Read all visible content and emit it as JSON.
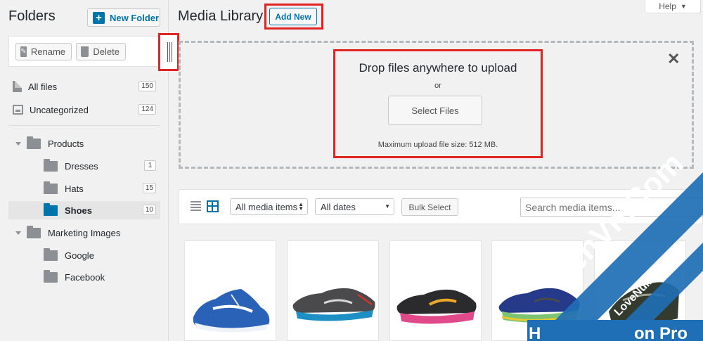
{
  "sidebar": {
    "title": "Folders",
    "new_folder_label": "New Folder",
    "rename_label": "Rename",
    "delete_label": "Delete",
    "all_files": {
      "label": "All files",
      "count": "150"
    },
    "uncategorized": {
      "label": "Uncategorized",
      "count": "124"
    },
    "folders": [
      {
        "label": "Products"
      },
      {
        "label": "Dresses",
        "count": "1"
      },
      {
        "label": "Hats",
        "count": "15"
      },
      {
        "label": "Shoes",
        "count": "10"
      },
      {
        "label": "Marketing Images"
      },
      {
        "label": "Google"
      },
      {
        "label": "Facebook"
      }
    ]
  },
  "header": {
    "title": "Media Library",
    "add_new_label": "Add New",
    "help_label": "Help"
  },
  "upload": {
    "drop_text": "Drop files anywhere to upload",
    "or_text": "or",
    "select_label": "Select Files",
    "max_size_text": "Maximum upload file size: 512 MB."
  },
  "toolbar": {
    "type_filter": "All media items",
    "date_filter": "All dates",
    "bulk_label": "Bulk Select",
    "search_placeholder": "Search media items..."
  },
  "media": [
    {
      "name": "shoe-blue",
      "color": "#2a62b7"
    },
    {
      "name": "shoe-grey",
      "color": "#4a4a4c"
    },
    {
      "name": "shoe-pink",
      "color": "#2b2b2d"
    },
    {
      "name": "shoe-navy",
      "color": "#263a8a"
    },
    {
      "name": "shoe-dark",
      "color": "#333a2e"
    }
  ],
  "colors": {
    "accent": "#0073aa",
    "highlight": "#e02424",
    "watermark": "#1e6fb5"
  }
}
